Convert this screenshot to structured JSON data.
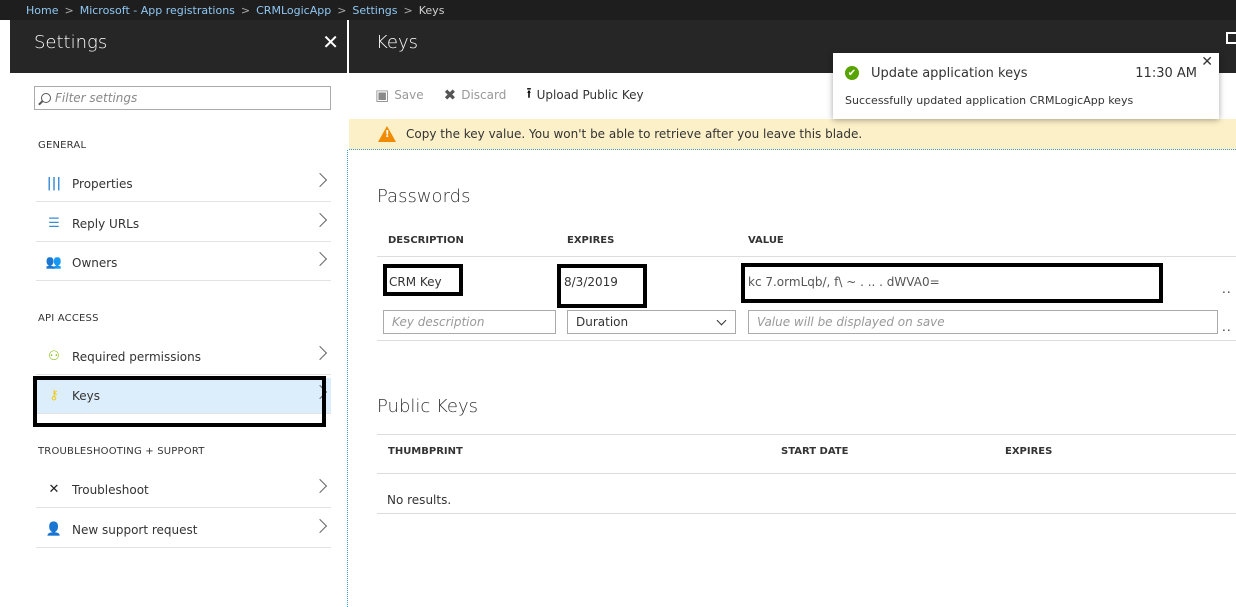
{
  "breadcrumb": {
    "items": [
      "Home",
      "Microsoft - App registrations",
      "CRMLogicApp",
      "Settings"
    ],
    "current": "Keys"
  },
  "left_blade": {
    "title": "Settings",
    "close_label": "✕",
    "filter_placeholder": "Filter settings",
    "sections": {
      "general": "GENERAL",
      "api_access": "API ACCESS",
      "troubleshooting": "TROUBLESHOOTING + SUPPORT"
    },
    "items": {
      "properties": "Properties",
      "reply_urls": "Reply URLs",
      "owners": "Owners",
      "required_permissions": "Required permissions",
      "keys": "Keys",
      "troubleshoot": "Troubleshoot",
      "new_support_request": "New support request"
    },
    "selected_item": "keys"
  },
  "right_blade": {
    "title": "Keys",
    "toolbar": {
      "save": "Save",
      "discard": "Discard",
      "upload": "Upload Public Key"
    },
    "warning": "Copy the key value. You won't be able to retrieve after you leave this blade.",
    "passwords": {
      "title": "Passwords",
      "columns": [
        "DESCRIPTION",
        "EXPIRES",
        "VALUE"
      ],
      "row": {
        "description": "CRM Key",
        "expires": "8/3/2019",
        "value": "kc  7.ormLqb/, f\\  ~  .  ..  .  dWVA0="
      },
      "new_row": {
        "description_placeholder": "Key description",
        "duration": "Duration",
        "value_placeholder": "Value will be displayed on save"
      },
      "more": ".."
    },
    "public_keys": {
      "title": "Public Keys",
      "columns": [
        "THUMBPRINT",
        "START DATE",
        "EXPIRES"
      ],
      "empty": "No results."
    }
  },
  "toast": {
    "title": "Update application keys",
    "time": "11:30 AM",
    "message": "Successfully updated application CRMLogicApp keys",
    "close": "✕"
  }
}
